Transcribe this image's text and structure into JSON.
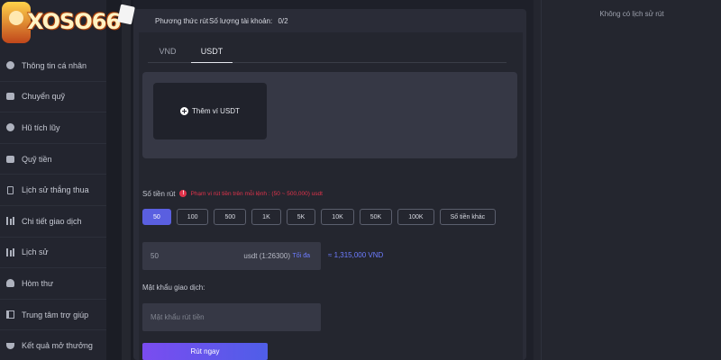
{
  "logo": {
    "text": "XOSO66"
  },
  "sidebar": {
    "items": [
      {
        "label": "Thông tin cá nhân",
        "icon": "user-icon"
      },
      {
        "label": "Chuyển quỹ",
        "icon": "wallet-icon"
      },
      {
        "label": "Hũ tích lũy",
        "icon": "coin-icon"
      },
      {
        "label": "Quỹ tiền",
        "icon": "fund-icon"
      },
      {
        "label": "Lịch sử thắng thua",
        "icon": "document-icon"
      },
      {
        "label": "Chi tiết giao dịch",
        "icon": "chart-icon"
      },
      {
        "label": "Lịch sử",
        "icon": "history-icon"
      },
      {
        "label": "Hòm thư",
        "icon": "mail-icon"
      },
      {
        "label": "Trung tâm trợ giúp",
        "icon": "help-book-icon"
      },
      {
        "label": "Kết quả mở thưởng",
        "icon": "trophy-icon"
      }
    ]
  },
  "header": {
    "method_label": "Phương thức rút",
    "accounts_label": "Số lượng tài khoản:",
    "accounts_value": "0/2"
  },
  "tabs": [
    {
      "label": "VND",
      "active": false
    },
    {
      "label": "USDT",
      "active": true
    }
  ],
  "wallet": {
    "add_label": "Thêm ví USDT"
  },
  "amount": {
    "label": "Số tiền rút",
    "range_note": "Phạm vi rút tiền trên mỗi lệnh : (50 ~ 500,000) usdt",
    "chips": [
      "50",
      "100",
      "500",
      "1K",
      "5K",
      "10K",
      "50K",
      "100K",
      "Số tiền khác"
    ],
    "selected_chip": "50",
    "value": "50",
    "unit": "usdt (1:26300)",
    "max_label": "Tối đa",
    "converted": "≈ 1,315,000 VND"
  },
  "password": {
    "label": "Mật khẩu giao dịch:",
    "placeholder": "Mật khẩu rút tiền"
  },
  "submit_label": "Rút ngay",
  "history": {
    "empty_text": "Không có lịch sử rút"
  },
  "colors": {
    "accent": "#5a5fe0",
    "warning": "#e0334b",
    "link": "#6d7cff",
    "background": "#1e2029"
  }
}
